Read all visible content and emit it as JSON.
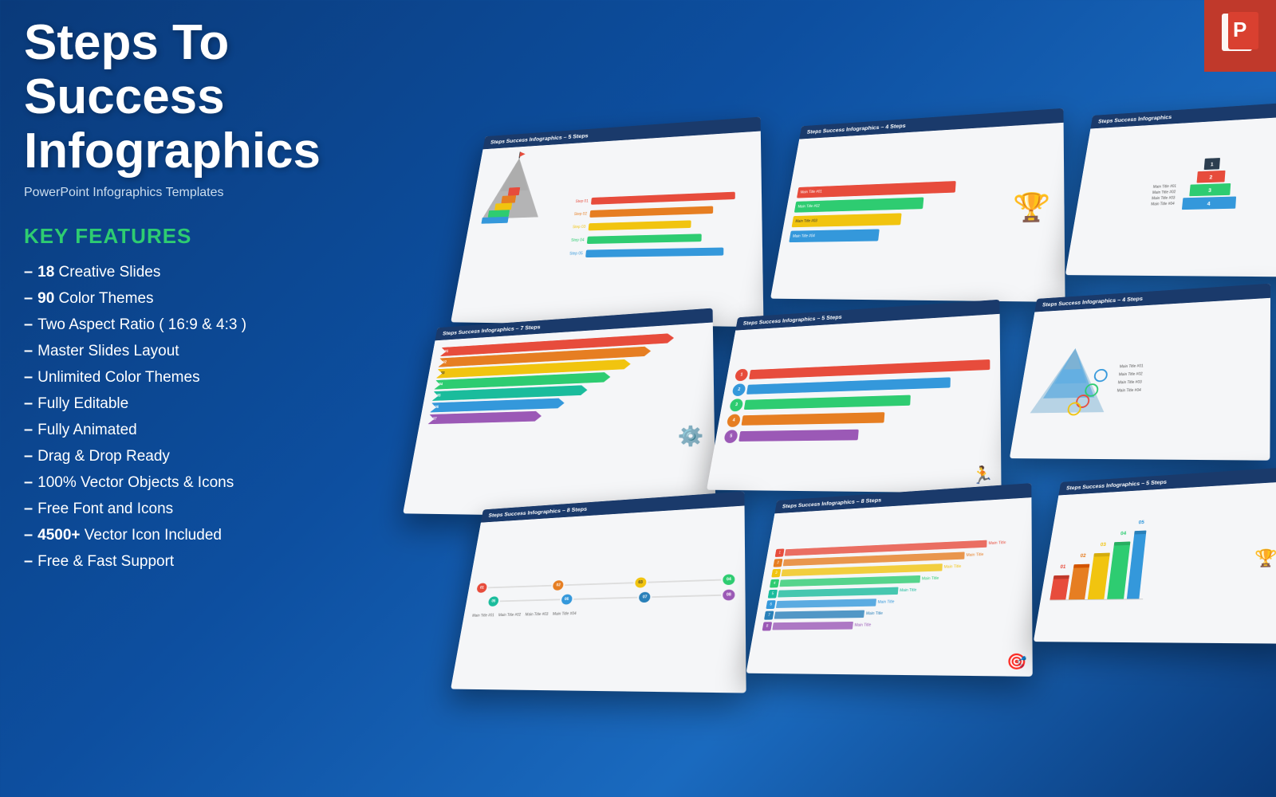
{
  "header": {
    "title": "Steps To Success Infographics",
    "subtitle": "PowerPoint Infographics Templates"
  },
  "ppt_icon": {
    "label": "P"
  },
  "key_features": {
    "title": "KEY FEATURES",
    "items": [
      {
        "dash": "–",
        "bold": "18",
        "text": " Creative Slides"
      },
      {
        "dash": "–",
        "bold": "90",
        "text": " Color Themes"
      },
      {
        "dash": "–",
        "bold": "Two",
        "text": " Aspect Ratio ( 16:9 & 4:3 )"
      },
      {
        "dash": "–",
        "bold": "Master",
        "text": " Slides Layout"
      },
      {
        "dash": "–",
        "bold": "Unlimited",
        "text": " Color Themes"
      },
      {
        "dash": "–",
        "bold": "Fully",
        "text": " Editable"
      },
      {
        "dash": "–",
        "bold": "Fully",
        "text": " Animated"
      },
      {
        "dash": "–",
        "bold": "Drag",
        "text": " & Drop Ready"
      },
      {
        "dash": "–",
        "bold": "100%",
        "text": " Vector Objects & Icons"
      },
      {
        "dash": "–",
        "bold": "Free",
        "text": " Font and Icons"
      },
      {
        "dash": "–",
        "bold": "4500+",
        "text": " Vector Icon Included"
      },
      {
        "dash": "–",
        "bold": "Free",
        "text": " & Fast Support"
      }
    ]
  },
  "slides": [
    {
      "id": 1,
      "header": "Steps Success Infographics – 5 Steps",
      "type": "mountain-steps"
    },
    {
      "id": 2,
      "header": "Steps Success Infographics – 4 Steps",
      "type": "bar-steps"
    },
    {
      "id": 3,
      "header": "Steps Success Infographics",
      "type": "pyramid"
    },
    {
      "id": 4,
      "header": "Steps Success Infographics – 7 Steps",
      "type": "arrow-steps"
    },
    {
      "id": 5,
      "header": "Steps Success Infographics – 5 Steps",
      "type": "bar-horizontal"
    },
    {
      "id": 6,
      "header": "Steps Success Infographics – 4 Steps",
      "type": "mountain-blue"
    },
    {
      "id": 7,
      "header": "Steps Success Infographics – 8 Steps",
      "type": "timeline"
    },
    {
      "id": 8,
      "header": "Steps Success Infographics – 8 Steps",
      "type": "colorbar"
    },
    {
      "id": 9,
      "header": "Steps Success Infographics – 5 Steps",
      "type": "isosteps"
    }
  ],
  "colors": {
    "accent_green": "#2ecc71",
    "background": "#0a3a7a",
    "ppt_red": "#c0392b",
    "slide_bg": "#f5f6f8"
  }
}
